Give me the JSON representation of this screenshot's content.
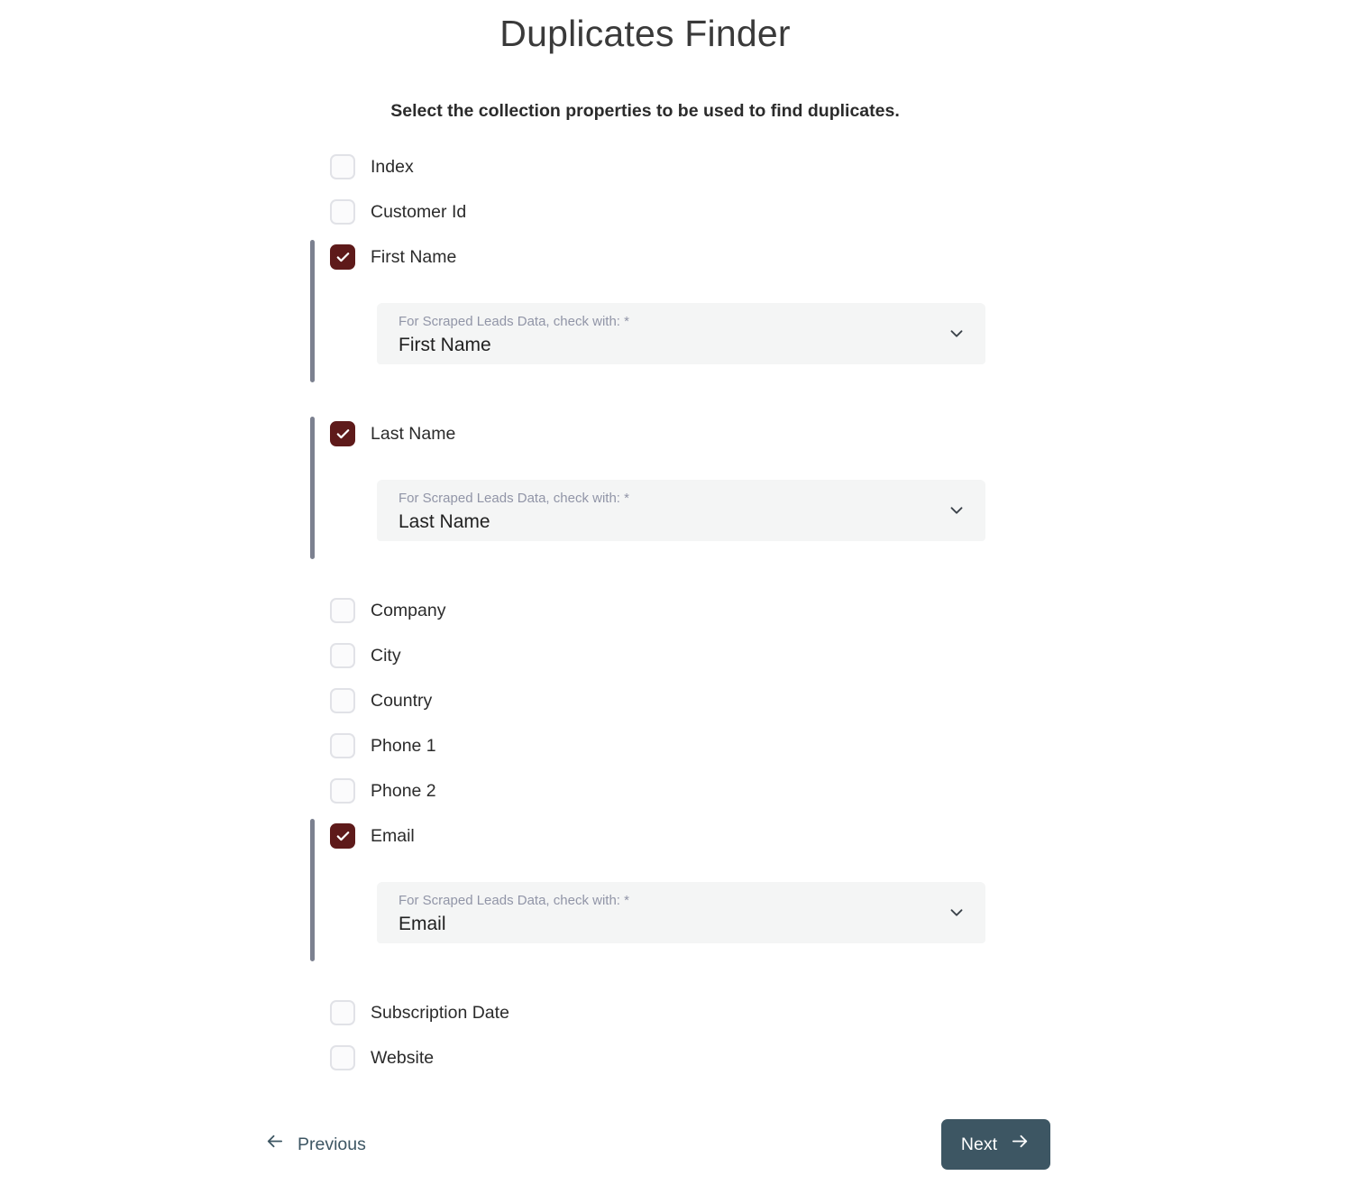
{
  "header": {
    "title": "Duplicates Finder",
    "subtitle": "Select the collection properties to be used to find duplicates."
  },
  "colors": {
    "checkbox_checked": "#5e1a1a",
    "checkbox_unchecked_border": "#e1e2e7",
    "group_rail": "#7c8190",
    "next_button_bg": "#3d5663",
    "dropdown_bg": "#f4f5f5",
    "dropdown_label": "#9195a7",
    "page_bg": "#ffffff"
  },
  "properties": [
    {
      "label": "Index",
      "checked": false
    },
    {
      "label": "Customer Id",
      "checked": false
    },
    {
      "label": "First Name",
      "checked": true,
      "dropdown": {
        "label": "For Scraped Leads Data, check with: *",
        "value": "First Name",
        "icon": "chevron-down-icon"
      }
    },
    {
      "label": "Last Name",
      "checked": true,
      "dropdown": {
        "label": "For Scraped Leads Data, check with: *",
        "value": "Last Name",
        "icon": "chevron-down-icon"
      }
    },
    {
      "label": "Company",
      "checked": false
    },
    {
      "label": "City",
      "checked": false
    },
    {
      "label": "Country",
      "checked": false
    },
    {
      "label": "Phone 1",
      "checked": false
    },
    {
      "label": "Phone 2",
      "checked": false
    },
    {
      "label": "Email",
      "checked": true,
      "dropdown": {
        "label": "For Scraped Leads Data, check with: *",
        "value": "Email",
        "icon": "chevron-down-icon"
      }
    },
    {
      "label": "Subscription Date",
      "checked": false
    },
    {
      "label": "Website",
      "checked": false
    }
  ],
  "footer": {
    "previous_label": "Previous",
    "previous_icon": "arrow-left-icon",
    "next_label": "Next",
    "next_icon": "arrow-right-icon"
  }
}
